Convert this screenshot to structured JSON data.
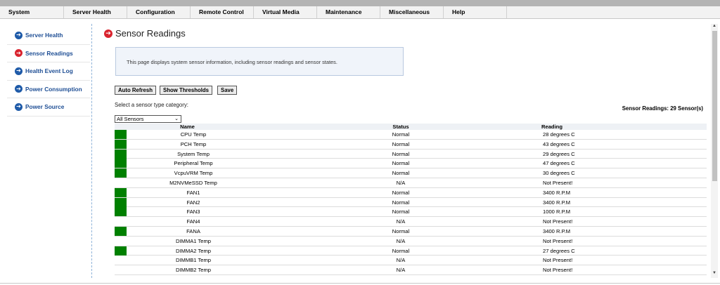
{
  "menu": [
    "System",
    "Server Health",
    "Configuration",
    "Remote Control",
    "Virtual Media",
    "Maintenance",
    "Miscellaneous",
    "Help"
  ],
  "sidebar": {
    "items": [
      {
        "label": "Server Health",
        "active": false
      },
      {
        "label": "Sensor Readings",
        "active": true
      },
      {
        "label": "Health Event Log",
        "active": false
      },
      {
        "label": "Power Consumption",
        "active": false
      },
      {
        "label": "Power Source",
        "active": false
      }
    ]
  },
  "page": {
    "title": "Sensor Readings",
    "info": "This page displays system sensor information, including sensor readings and sensor states."
  },
  "buttons": {
    "auto_refresh": "Auto Refresh",
    "show_thresholds": "Show Thresholds",
    "save": "Save"
  },
  "filter": {
    "label": "Select a sensor type category:",
    "selected": "All Sensors"
  },
  "sensor_count": "Sensor Readings: 29 Sensor(s)",
  "table": {
    "headers": {
      "name": "Name",
      "status": "Status",
      "reading": "Reading"
    },
    "rows": [
      {
        "name": "CPU Temp",
        "status": "Normal",
        "reading": "28 degrees C",
        "indicator": true
      },
      {
        "name": "PCH Temp",
        "status": "Normal",
        "reading": "43 degrees C",
        "indicator": true
      },
      {
        "name": "System Temp",
        "status": "Normal",
        "reading": "29 degrees C",
        "indicator": true
      },
      {
        "name": "Peripheral Temp",
        "status": "Normal",
        "reading": "47 degrees C",
        "indicator": true
      },
      {
        "name": "VcpuVRM Temp",
        "status": "Normal",
        "reading": "30 degrees C",
        "indicator": true
      },
      {
        "name": "M2NVMeSSD Temp",
        "status": "N/A",
        "reading": "Not Present!",
        "indicator": false
      },
      {
        "name": "FAN1",
        "status": "Normal",
        "reading": "3400 R.P.M",
        "indicator": true
      },
      {
        "name": "FAN2",
        "status": "Normal",
        "reading": "3400 R.P.M",
        "indicator": true
      },
      {
        "name": "FAN3",
        "status": "Normal",
        "reading": "1000 R.P.M",
        "indicator": true
      },
      {
        "name": "FAN4",
        "status": "N/A",
        "reading": "Not Present!",
        "indicator": false
      },
      {
        "name": "FANA",
        "status": "Normal",
        "reading": "3400 R.P.M",
        "indicator": true
      },
      {
        "name": "DIMMA1 Temp",
        "status": "N/A",
        "reading": "Not Present!",
        "indicator": false
      },
      {
        "name": "DIMMA2 Temp",
        "status": "Normal",
        "reading": "27 degrees C",
        "indicator": true
      },
      {
        "name": "DIMMB1 Temp",
        "status": "N/A",
        "reading": "Not Present!",
        "indicator": false
      },
      {
        "name": "DIMMB2 Temp",
        "status": "N/A",
        "reading": "Not Present!",
        "indicator": false
      }
    ]
  },
  "colors": {
    "indicator_normal": "#008000",
    "active_icon": "#d9232e",
    "nav_icon": "#1e5aa8",
    "nav_text": "#1f4f95"
  }
}
